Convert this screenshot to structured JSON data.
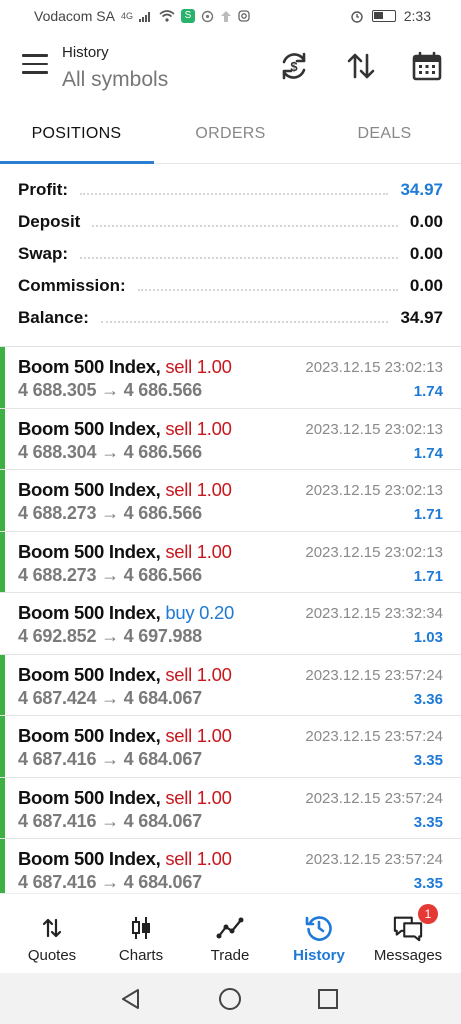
{
  "status_bar": {
    "carrier": "Vodacom SA",
    "network": "4G",
    "time": "2:33"
  },
  "header": {
    "title": "History",
    "subtitle": "All symbols"
  },
  "tabs": [
    {
      "label": "POSITIONS",
      "active": true
    },
    {
      "label": "ORDERS",
      "active": false
    },
    {
      "label": "DEALS",
      "active": false
    }
  ],
  "summary": [
    {
      "label": "Profit:",
      "value": "34.97",
      "highlight": true
    },
    {
      "label": "Deposit",
      "value": "0.00",
      "highlight": false
    },
    {
      "label": "Swap:",
      "value": "0.00",
      "highlight": false
    },
    {
      "label": "Commission:",
      "value": "0.00",
      "highlight": false
    },
    {
      "label": "Balance:",
      "value": "34.97",
      "highlight": false
    }
  ],
  "deals": [
    {
      "symbol": "Boom 500 Index,",
      "side": "sell 1.00",
      "type": "sell",
      "price": "4 688.305 → 4 686.566",
      "time": "2023.12.15 23:02:13",
      "profit": "1.74",
      "marked": true
    },
    {
      "symbol": "Boom 500 Index,",
      "side": "sell 1.00",
      "type": "sell",
      "price": "4 688.304 → 4 686.566",
      "time": "2023.12.15 23:02:13",
      "profit": "1.74",
      "marked": true
    },
    {
      "symbol": "Boom 500 Index,",
      "side": "sell 1.00",
      "type": "sell",
      "price": "4 688.273 → 4 686.566",
      "time": "2023.12.15 23:02:13",
      "profit": "1.71",
      "marked": true
    },
    {
      "symbol": "Boom 500 Index,",
      "side": "sell 1.00",
      "type": "sell",
      "price": "4 688.273 → 4 686.566",
      "time": "2023.12.15 23:02:13",
      "profit": "1.71",
      "marked": true
    },
    {
      "symbol": "Boom 500 Index,",
      "side": "buy 0.20",
      "type": "buy",
      "price": "4 692.852 → 4 697.988",
      "time": "2023.12.15 23:32:34",
      "profit": "1.03",
      "marked": false
    },
    {
      "symbol": "Boom 500 Index,",
      "side": "sell 1.00",
      "type": "sell",
      "price": "4 687.424 → 4 684.067",
      "time": "2023.12.15 23:57:24",
      "profit": "3.36",
      "marked": true
    },
    {
      "symbol": "Boom 500 Index,",
      "side": "sell 1.00",
      "type": "sell",
      "price": "4 687.416 → 4 684.067",
      "time": "2023.12.15 23:57:24",
      "profit": "3.35",
      "marked": true
    },
    {
      "symbol": "Boom 500 Index,",
      "side": "sell 1.00",
      "type": "sell",
      "price": "4 687.416 → 4 684.067",
      "time": "2023.12.15 23:57:24",
      "profit": "3.35",
      "marked": true
    },
    {
      "symbol": "Boom 500 Index,",
      "side": "sell 1.00",
      "type": "sell",
      "price": "4 687.416 → 4 684.067",
      "time": "2023.12.15 23:57:24",
      "profit": "3.35",
      "marked": true
    }
  ],
  "bottom_nav": [
    {
      "label": "Quotes",
      "icon": "quotes-icon",
      "active": false
    },
    {
      "label": "Charts",
      "icon": "charts-icon",
      "active": false
    },
    {
      "label": "Trade",
      "icon": "trade-icon",
      "active": false
    },
    {
      "label": "History",
      "icon": "history-icon",
      "active": true
    },
    {
      "label": "Messages",
      "icon": "messages-icon",
      "active": false,
      "badge": "1"
    }
  ],
  "colors": {
    "accent": "#1e7ad6",
    "sell": "#c8181e",
    "buy": "#1e7ad6",
    "marker": "#3cb043"
  }
}
